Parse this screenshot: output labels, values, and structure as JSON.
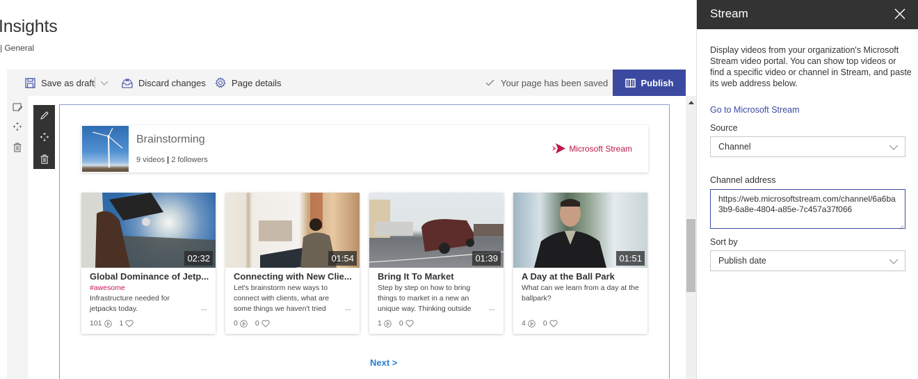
{
  "page": {
    "title": "Insights",
    "subtitle": "| General"
  },
  "commandbar": {
    "save_draft": "Save as draft",
    "discard": "Discard changes",
    "page_details": "Page details",
    "saved_status": "Your page has been saved",
    "publish": "Publish",
    "accent": "#3b4aa0"
  },
  "channel": {
    "name": "Brainstorming",
    "videos": "9 videos",
    "separator": "|",
    "followers": "2 followers",
    "brand_label": "Microsoft Stream",
    "brand_color": "#bc1948"
  },
  "videos": [
    {
      "title": "Global Dominance of Jetp...",
      "tag": "#awesome",
      "description": "Infrastructure needed for jetpacks today.",
      "duration": "02:32",
      "views": "101",
      "likes": "1",
      "more": "..."
    },
    {
      "title": "Connecting with New Clie...",
      "tag": "",
      "description": "Let's brainstorm new ways to connect with clients, what are some things we haven't tried",
      "duration": "01:54",
      "views": "0",
      "likes": "0",
      "more": "..."
    },
    {
      "title": "Bring It To Market",
      "tag": "",
      "description": "Step by step on how to bring things to market in a new an unique way. Thinking outside",
      "duration": "01:39",
      "views": "1",
      "likes": "0",
      "more": "..."
    },
    {
      "title": "A Day at the Ball Park",
      "tag": "",
      "description": "What can we learn from a day at the ballpark?",
      "duration": "01:51",
      "views": "4",
      "likes": "0",
      "more": ""
    }
  ],
  "pagination": {
    "next": "Next >"
  },
  "pane": {
    "title": "Stream",
    "description": "Display videos from your organization's Microsoft Stream video portal. You can show top videos or find a specific video or channel in Stream, and paste its web address below.",
    "link": "Go to Microsoft Stream",
    "source_label": "Source",
    "source_value": "Channel",
    "channel_address_label": "Channel address",
    "channel_address_value": "https://web.microsoftstream.com/channel/6a6ba3b9-6a8e-4804-a85e-7c457a37f066",
    "sort_label": "Sort by",
    "sort_value": "Publish date"
  }
}
